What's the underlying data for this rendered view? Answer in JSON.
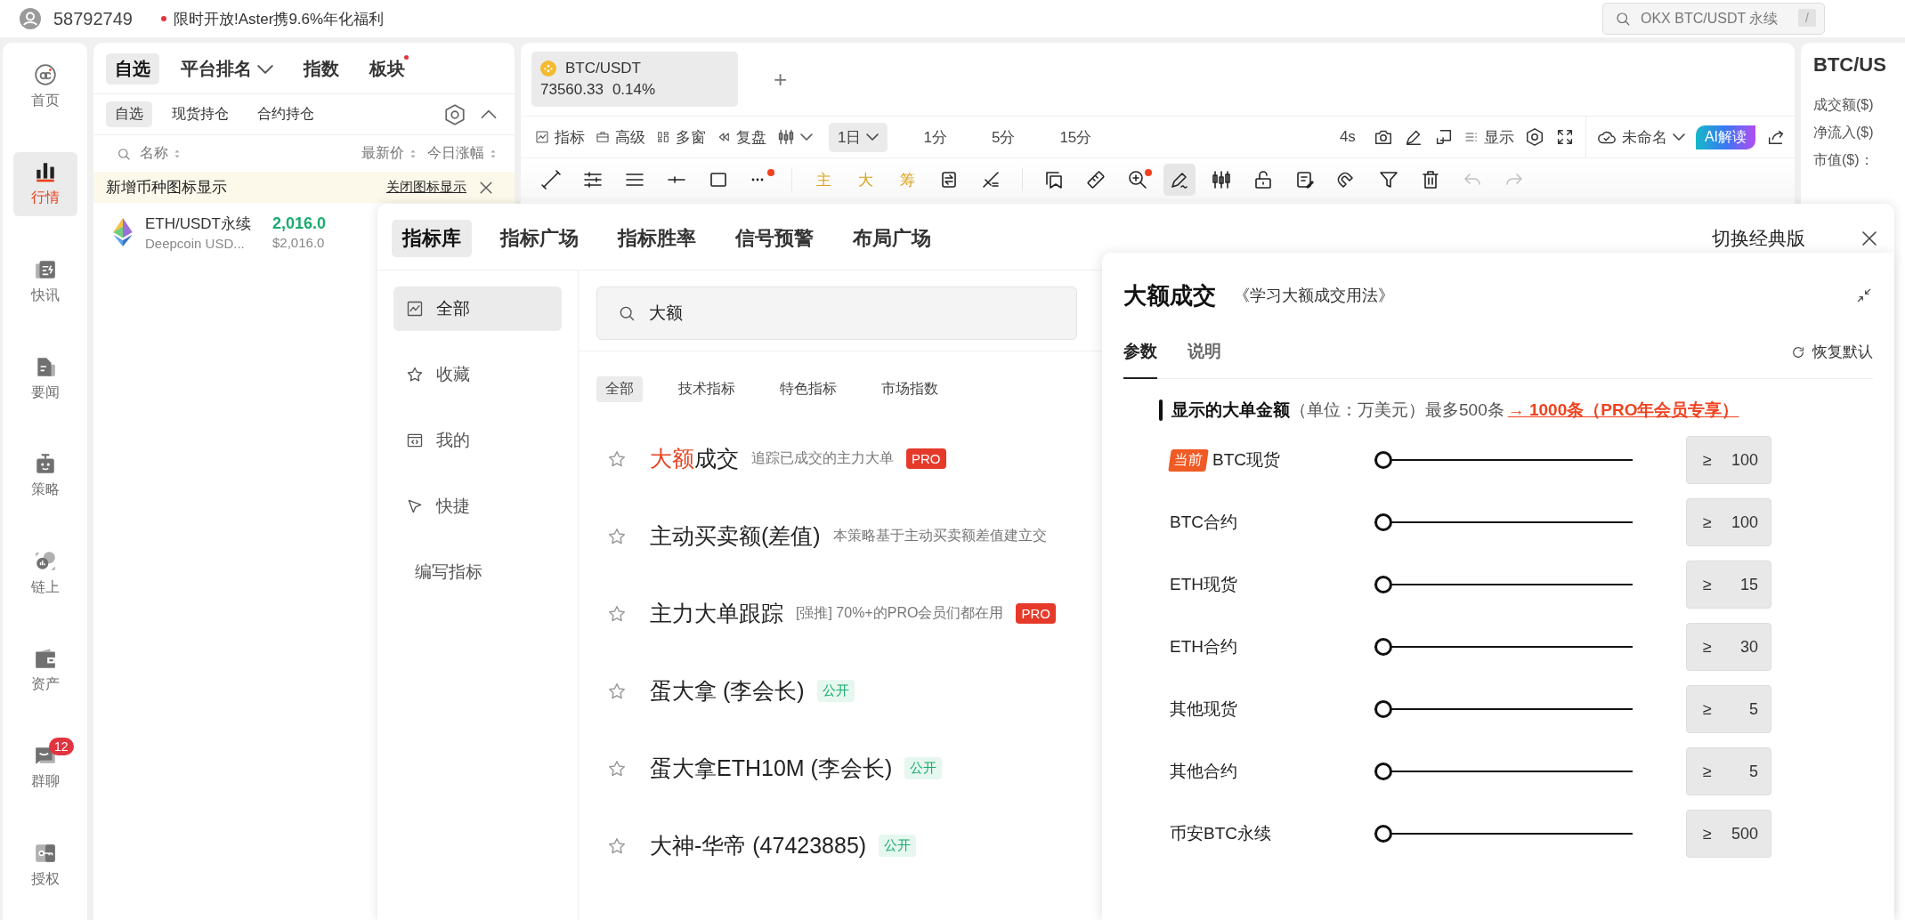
{
  "top_bar": {
    "user_id": "58792749",
    "promo": {
      "text": "限时开放!Aster携9.6%年化福利",
      "dot": true
    },
    "search": {
      "placeholder": "OKX BTC/USDT 永续",
      "shortcut": "/"
    }
  },
  "nav": [
    {
      "label": "首页",
      "selected": false
    },
    {
      "label": "行情",
      "selected": true
    },
    {
      "label": "快讯",
      "selected": false
    },
    {
      "label": "要闻",
      "selected": false
    },
    {
      "label": "策略",
      "selected": false
    },
    {
      "label": "链上",
      "selected": false
    },
    {
      "label": "资产",
      "selected": false
    },
    {
      "label": "群聊",
      "selected": false,
      "badge": "12"
    },
    {
      "label": "授权",
      "selected": false
    }
  ],
  "watchlist": {
    "tabs": [
      {
        "label": "自选",
        "selected": true,
        "dropdown": false,
        "dot": false
      },
      {
        "label": "平台排名",
        "selected": false,
        "dropdown": true,
        "dot": false
      },
      {
        "label": "指数",
        "selected": false,
        "dropdown": false,
        "dot": false
      },
      {
        "label": "板块",
        "selected": false,
        "dropdown": false,
        "dot": true
      }
    ],
    "sub_tabs": [
      {
        "label": "自选",
        "selected": true
      },
      {
        "label": "现货持仓",
        "selected": false
      },
      {
        "label": "合约持仓",
        "selected": false
      }
    ],
    "columns": [
      "名称",
      "最新价",
      "今日涨幅"
    ],
    "notice": {
      "text": "新增币种图标显示",
      "action": "关闭图标显示"
    },
    "rows": [
      {
        "symbol": "ETH/USDT永续",
        "exchange": "Deepcoin USD...",
        "price": "2,016.0",
        "price_usd": "$2,016.0"
      }
    ]
  },
  "chart": {
    "pair_tab": {
      "symbol": "BTC/USDT",
      "price": "73560.33",
      "change": "0.14%",
      "selected": true
    },
    "add": "+",
    "toolbar": {
      "tools": [
        {
          "label": "指标"
        },
        {
          "label": "高级"
        },
        {
          "label": "多窗"
        },
        {
          "label": "复盘"
        }
      ],
      "intervals": [
        {
          "label": "1日",
          "selected": true,
          "dropdown": true
        },
        {
          "label": "1分",
          "selected": false,
          "dropdown": false
        },
        {
          "label": "5分",
          "selected": false,
          "dropdown": false
        },
        {
          "label": "15分",
          "selected": false,
          "dropdown": false
        }
      ],
      "refresh": "4s",
      "display": "显示",
      "layout": "未命名",
      "ai": "AI解读"
    },
    "drawing_tools": [
      {
        "kind": "icon",
        "selected": false,
        "dot": false,
        "disabled": false
      },
      {
        "kind": "icon",
        "selected": false,
        "dot": false,
        "disabled": false
      },
      {
        "kind": "icon",
        "selected": false,
        "dot": false,
        "disabled": false
      },
      {
        "kind": "icon",
        "selected": false,
        "dot": false,
        "disabled": false
      },
      {
        "kind": "icon",
        "selected": false,
        "dot": false,
        "disabled": false
      },
      {
        "kind": "icon",
        "selected": false,
        "dot": true,
        "disabled": false
      },
      {
        "kind": "divider"
      },
      {
        "kind": "text",
        "label": "主",
        "selected": false,
        "dot": false,
        "disabled": false
      },
      {
        "kind": "text",
        "label": "大",
        "selected": false,
        "dot": false,
        "disabled": false
      },
      {
        "kind": "text",
        "label": "筹",
        "selected": false,
        "dot": false,
        "disabled": false
      },
      {
        "kind": "icon",
        "selected": false,
        "dot": false,
        "disabled": false
      },
      {
        "kind": "icon",
        "selected": false,
        "dot": false,
        "disabled": false
      },
      {
        "kind": "divider"
      },
      {
        "kind": "icon",
        "selected": false,
        "dot": false,
        "disabled": false
      },
      {
        "kind": "icon",
        "selected": false,
        "dot": false,
        "disabled": false
      },
      {
        "kind": "icon",
        "selected": false,
        "dot": true,
        "disabled": false
      },
      {
        "kind": "icon",
        "selected": true,
        "dot": false,
        "disabled": false
      },
      {
        "kind": "icon",
        "selected": false,
        "dot": false,
        "disabled": false
      },
      {
        "kind": "icon",
        "selected": false,
        "dot": false,
        "disabled": false
      },
      {
        "kind": "icon",
        "selected": false,
        "dot": false,
        "disabled": false
      },
      {
        "kind": "icon",
        "selected": false,
        "dot": false,
        "disabled": false
      },
      {
        "kind": "icon",
        "selected": false,
        "dot": false,
        "disabled": false
      },
      {
        "kind": "icon",
        "selected": false,
        "dot": false,
        "disabled": false
      },
      {
        "kind": "icon",
        "selected": false,
        "dot": false,
        "disabled": true
      },
      {
        "kind": "icon",
        "selected": false,
        "dot": false,
        "disabled": true
      }
    ]
  },
  "info_panel": {
    "title": "BTC/US",
    "fields": [
      "成交额($)",
      "净流入($)",
      "市值($)："
    ]
  },
  "indicator_modal": {
    "tabs": [
      {
        "label": "指标库",
        "selected": true
      },
      {
        "label": "指标广场",
        "selected": false
      },
      {
        "label": "指标胜率",
        "selected": false
      },
      {
        "label": "信号预警",
        "selected": false
      },
      {
        "label": "布局广场",
        "selected": false
      }
    ],
    "switch": "切换经典版",
    "sidebar": [
      {
        "label": "全部",
        "selected": true,
        "kind": "category"
      },
      {
        "label": "收藏",
        "selected": false,
        "kind": "category"
      },
      {
        "label": "我的",
        "selected": false,
        "kind": "category"
      },
      {
        "label": "快捷",
        "selected": false,
        "kind": "category"
      },
      {
        "label": "编写指标",
        "selected": false,
        "kind": "action"
      }
    ],
    "search": {
      "value": "大额"
    },
    "filters": [
      {
        "label": "全部",
        "selected": true
      },
      {
        "label": "技术指标",
        "selected": false
      },
      {
        "label": "特色指标",
        "selected": false
      },
      {
        "label": "市场指数",
        "selected": false
      }
    ],
    "indicators": [
      {
        "name_match": "大额",
        "name": "成交",
        "description": "追踪已成交的主力大单",
        "badge": {
          "kind": "pro",
          "text": "PRO"
        }
      },
      {
        "name": "主动买卖额(差值)",
        "description": "本策略基于主动买卖额差值建立交"
      },
      {
        "name": "主力大单跟踪",
        "description": "[强推] 70%+的PRO会员们都在用",
        "badge": {
          "kind": "pro",
          "text": "PRO"
        }
      },
      {
        "name": "蛋大拿 (李会长)",
        "badge": {
          "kind": "public",
          "text": "公开"
        }
      },
      {
        "name": "蛋大拿ETH10M (李会长)",
        "badge": {
          "kind": "public",
          "text": "公开"
        }
      },
      {
        "name": "大神-华帝 (47423885)",
        "badge": {
          "kind": "public",
          "text": "公开"
        }
      }
    ],
    "detail": {
      "title": "大额成交",
      "guide": "《学习大额成交用法》",
      "tabs": [
        {
          "label": "参数",
          "selected": true
        },
        {
          "label": "说明",
          "selected": false
        }
      ],
      "reset": "恢复默认",
      "section": {
        "text": "**显示的大单金额**（单位：万美元）最多500条",
        "link": "→ 1000条（PRO年会员专享）"
      },
      "params": [
        {
          "label": "BTC现货",
          "tag": "当前",
          "level": 0,
          "op": "≥",
          "value": "100"
        },
        {
          "label": "BTC合约",
          "level": 0,
          "op": "≥",
          "value": "100"
        },
        {
          "label": "ETH现货",
          "level": 0,
          "op": "≥",
          "value": "15"
        },
        {
          "label": "ETH合约",
          "level": 0,
          "op": "≥",
          "value": "30"
        },
        {
          "label": "其他现货",
          "level": 0,
          "op": "≥",
          "value": "5"
        },
        {
          "label": "其他合约",
          "level": 0,
          "op": "≥",
          "value": "5"
        },
        {
          "label": "币安BTC永续",
          "level": 0,
          "op": "≥",
          "value": "500"
        }
      ]
    }
  }
}
